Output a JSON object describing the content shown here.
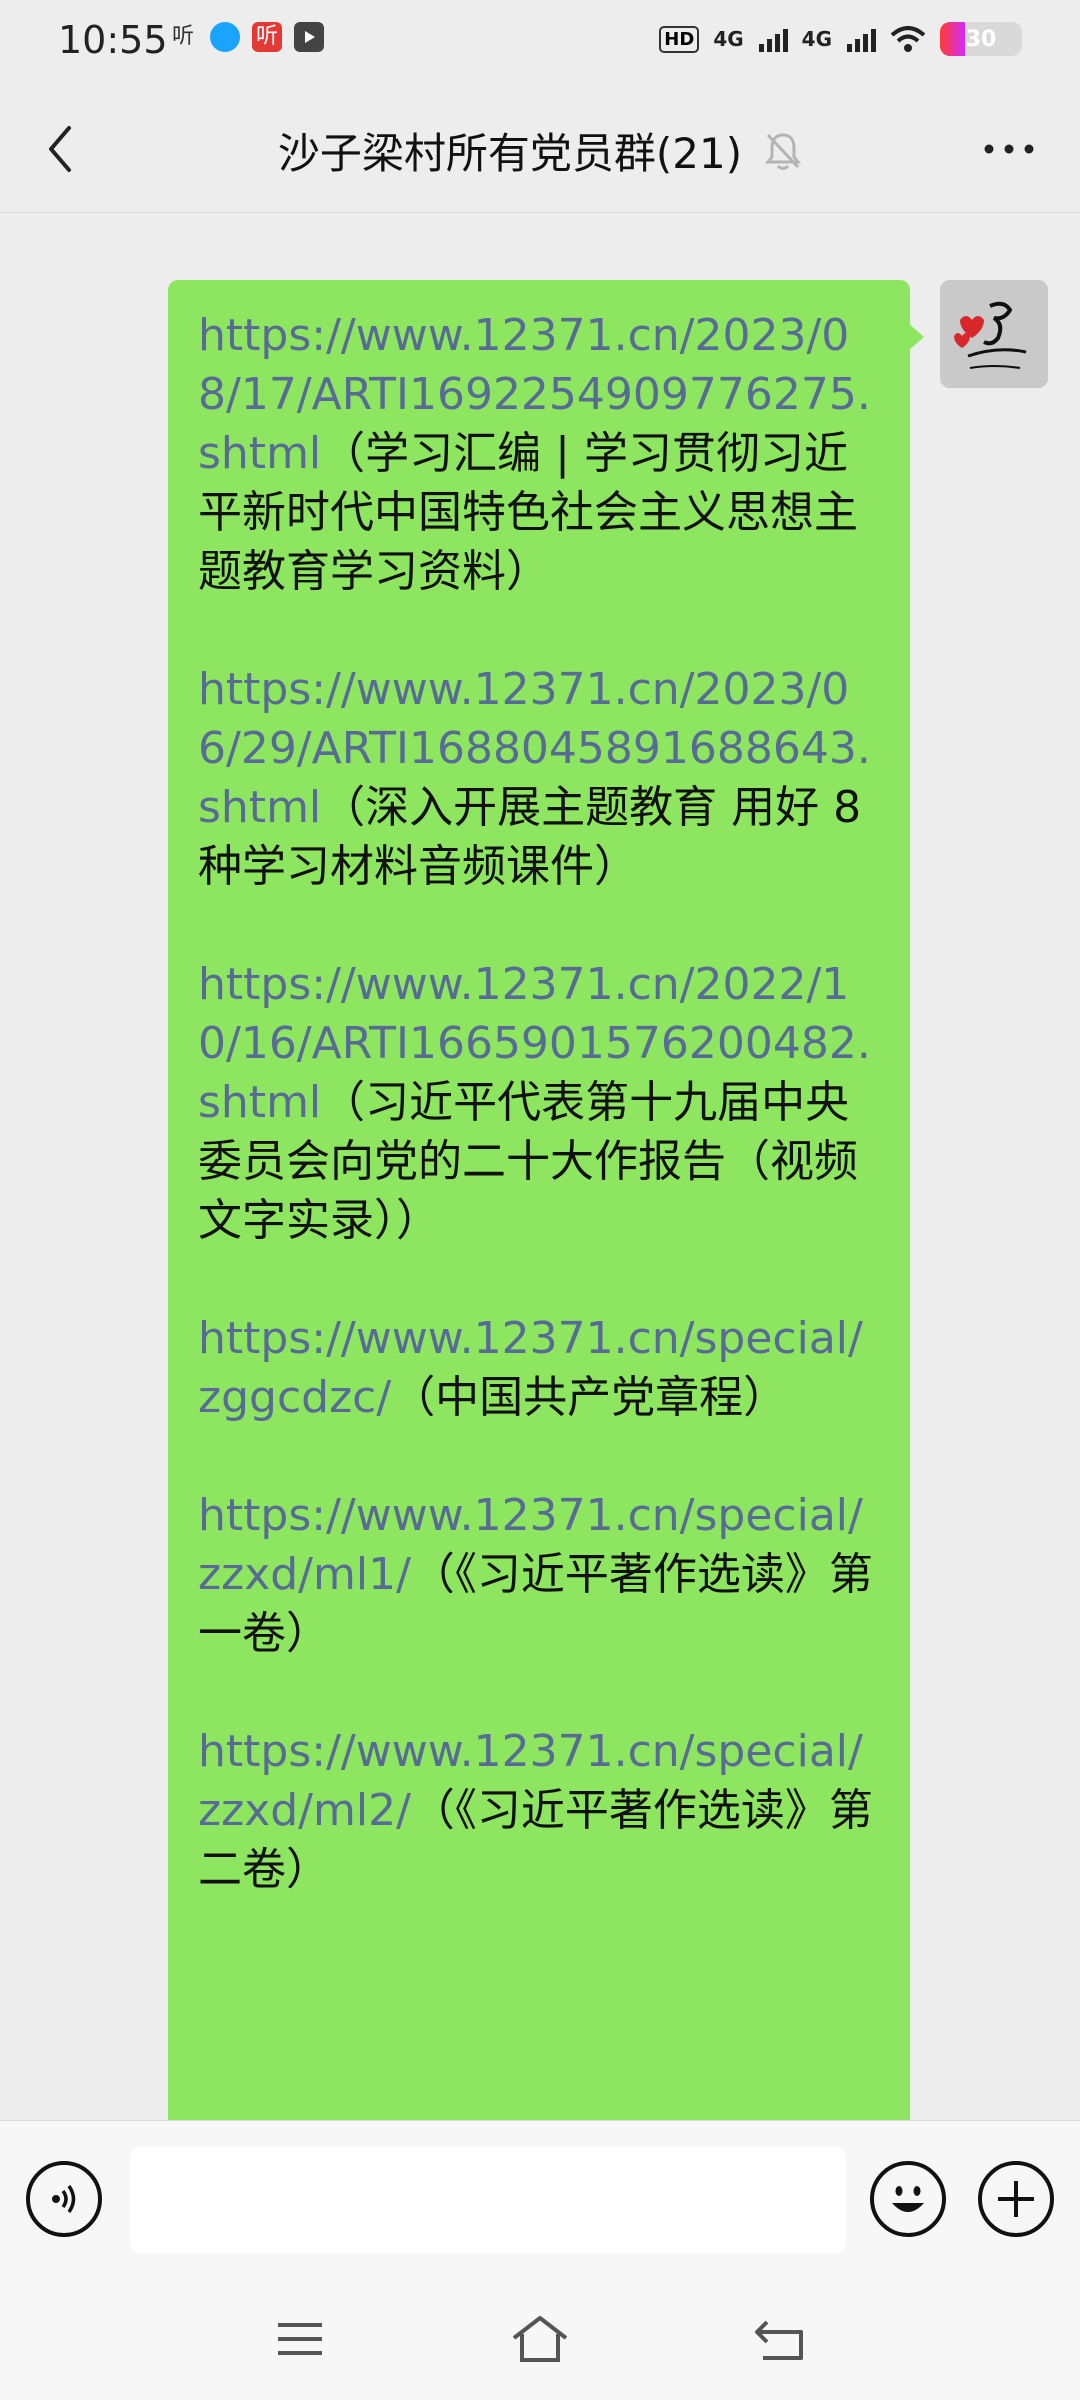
{
  "status_bar": {
    "time": "10:55",
    "app_icon_1": "听",
    "app_icon_2": "听",
    "hd_label": "HD",
    "net1": "4G",
    "net2": "4G",
    "battery": "30",
    "battery_fill_fraction": 0.3
  },
  "header": {
    "title": "沙子梁村所有党员群(21)",
    "icons": {
      "back": "back-arrow-icon",
      "mute": "mute-bell-icon",
      "more": "more-dots-icon"
    }
  },
  "messages": [
    {
      "link": "https://www.12371.cn/2023/08/17/ARTI1692254909776275.shtml",
      "desc": "（学习汇编 | 学习贯彻习近平新时代中国特色社会主义思想主题教育学习资料）"
    },
    {
      "link": "https://www.12371.cn/2023/06/29/ARTI1688045891688643.shtml",
      "desc": "（深入开展主题教育 用好 8 种学习材料音频课件）"
    },
    {
      "link": "https://www.12371.cn/2022/10/16/ARTI1665901576200482.shtml",
      "desc": "（习近平代表第十九届中央委员会向党的二十大作报告（视频文字实录））"
    },
    {
      "link": "https://www.12371.cn/special/zggcdzc/",
      "desc": "（中国共产党章程）"
    },
    {
      "link": "https://www.12371.cn/special/zzxd/ml1/",
      "desc": "（《习近平著作选读》第一卷）"
    },
    {
      "link": "https://www.12371.cn/special/zzxd/ml2/",
      "desc": "（《习近平著作选读》第二卷）"
    }
  ],
  "input_bar": {
    "icons": {
      "voice": "voice-icon",
      "emoji": "emoji-icon",
      "plus": "plus-icon"
    }
  },
  "nav_bar": {
    "icons": {
      "menu": "menu-icon",
      "home": "home-icon",
      "back": "back-icon"
    }
  },
  "colors": {
    "bubble": "#8ee55f",
    "link": "#576b95",
    "background": "#ededed"
  }
}
